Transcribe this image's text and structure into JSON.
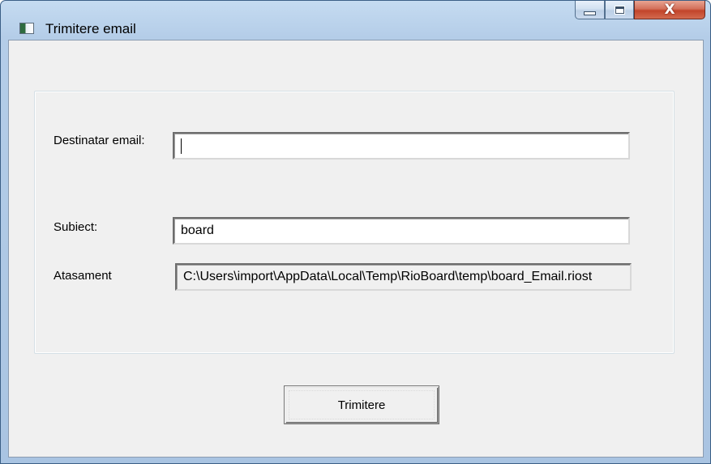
{
  "window": {
    "title": "Trimitere email",
    "app_icon": "window-app-icon",
    "controls": {
      "minimize_icon": "minimize-icon",
      "maximize_icon": "maximize-icon",
      "close_glyph": "X"
    }
  },
  "form": {
    "recipient": {
      "label": "Destinatar email:",
      "value": ""
    },
    "subject": {
      "label": "Subiect:",
      "value": "board"
    },
    "attachment": {
      "label": "Atasament",
      "value": "C:\\Users\\import\\AppData\\Local\\Temp\\RioBoard\\temp\\board_Email.riost"
    }
  },
  "actions": {
    "send_label": "Trimitere"
  },
  "colors": {
    "window_frame": "#a9c4e2",
    "client_background": "#f0f0f0",
    "close_button": "#c2442a"
  }
}
